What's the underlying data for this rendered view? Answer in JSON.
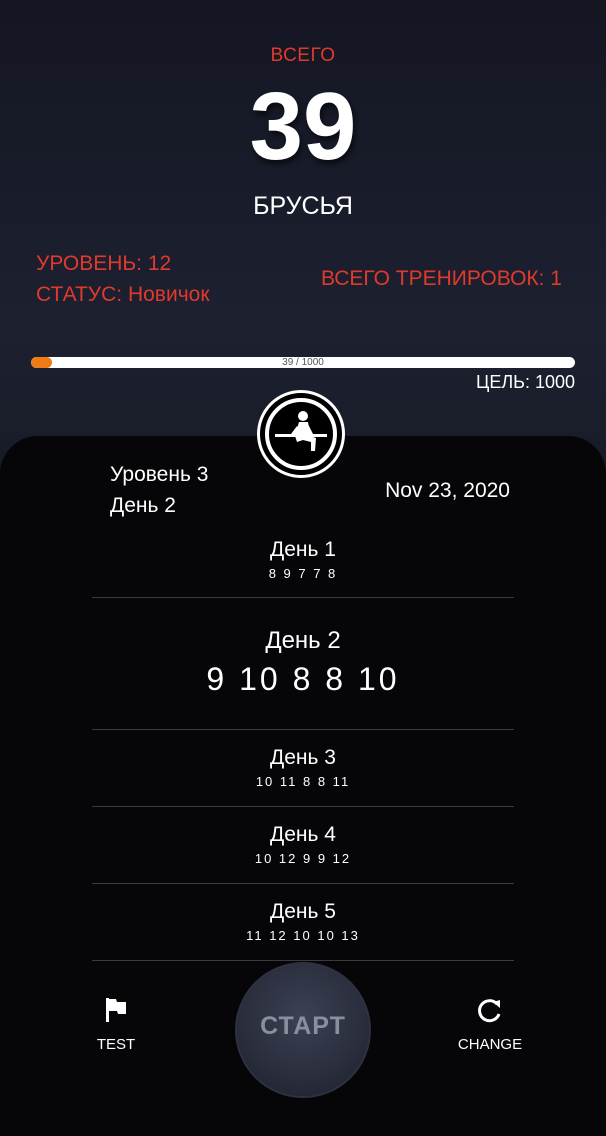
{
  "header": {
    "total_label": "ВСЕГО",
    "total_value": "39",
    "exercise_name": "БРУСЬЯ"
  },
  "stats": {
    "level": "УРОВЕНЬ: 12",
    "status": "СТАТУС: Новичок",
    "total_workouts": "ВСЕГО ТРЕНИРОВОК: 1"
  },
  "progress": {
    "text": "39 / 1000",
    "fraction": 0.039,
    "goal": "ЦЕЛЬ: 1000"
  },
  "program": {
    "level": "Уровень 3",
    "day": "День 2",
    "date": "Nov 23, 2020",
    "emblem_icon": "dips-figure-icon"
  },
  "days": [
    {
      "title": "День 1",
      "reps": "8 9 7 7 8"
    },
    {
      "title": "День 2",
      "reps": "9 10 8 8 10",
      "active": true
    },
    {
      "title": "День 3",
      "reps": "10 11 8 8 11"
    },
    {
      "title": "День 4",
      "reps": "10 12 9 9 12"
    },
    {
      "title": "День 5",
      "reps": "11 12 10 10 13"
    }
  ],
  "bottom_nav": {
    "test_label": "TEST",
    "test_icon": "flag-icon",
    "start_label": "СТАРТ",
    "change_label": "CHANGE",
    "change_icon": "refresh-icon"
  },
  "colors": {
    "accent_red": "#e13a2c",
    "progress_orange": "#f07a16"
  }
}
